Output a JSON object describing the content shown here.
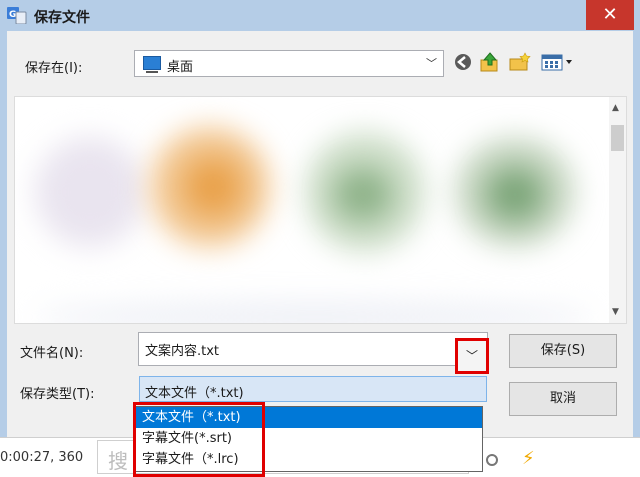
{
  "window": {
    "title": "保存文件",
    "close_glyph": "✕"
  },
  "toolbar": {
    "save_in_label": "保存在(I):",
    "save_in_value": "桌面",
    "icons": [
      "back-icon",
      "up-folder-icon",
      "new-folder-icon",
      "view-menu-icon"
    ]
  },
  "form": {
    "filename_label": "文件名(N):",
    "filename_value": "文案内容.txt",
    "filetype_label": "保存类型(T):",
    "filetype_value": "文本文件（*.txt)",
    "save_button": "保存(S)",
    "cancel_button": "取消"
  },
  "dropdown": {
    "options": [
      "文本文件（*.txt)",
      "字幕文件(*.srt)",
      "字幕文件（*.lrc)"
    ],
    "selected_index": 0
  },
  "background_app": {
    "timecode": "0:00:27, 360",
    "search_partial": "搜"
  },
  "colors": {
    "window_frame": "#b5cde7",
    "close_button": "#c7362c",
    "selection": "#0078d7",
    "highlight_box": "#e00000"
  }
}
